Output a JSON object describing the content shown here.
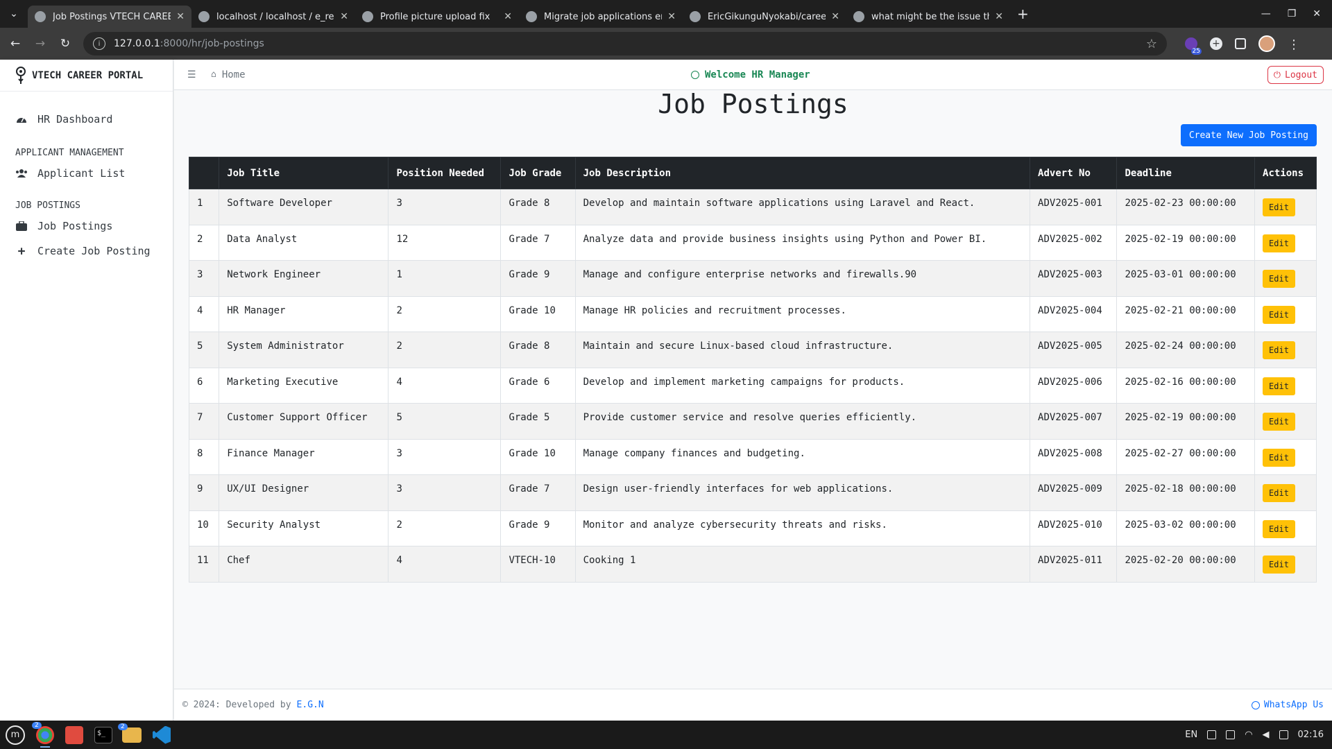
{
  "browser": {
    "tabs": [
      {
        "title": "Job Postings VTECH CAREER",
        "active": true
      },
      {
        "title": "localhost / localhost / e_recr",
        "active": false
      },
      {
        "title": "Profile picture upload fix",
        "active": false
      },
      {
        "title": "Migrate job applications erro",
        "active": false
      },
      {
        "title": "EricGikunguNyokabi/career-",
        "active": false
      },
      {
        "title": "what might be the issue that",
        "active": false
      }
    ],
    "url_host": "127.0.0.1",
    "url_path": ":8000/hr/job-postings",
    "extension_badge": "25"
  },
  "sidebar": {
    "brand": "VTECH CAREER PORTAL",
    "dashboard_label": "HR Dashboard",
    "section_applicants": "APPLICANT MANAGEMENT",
    "applicant_list_label": "Applicant List",
    "section_jobs": "JOB POSTINGS",
    "job_postings_label": "Job Postings",
    "create_job_label": "Create Job Posting"
  },
  "topnav": {
    "home_label": "Home",
    "welcome": "Welcome HR Manager",
    "logout_label": "Logout"
  },
  "main": {
    "title": "Job Postings",
    "create_button": "Create New Job Posting",
    "columns": [
      "",
      "Job Title",
      "Position Needed",
      "Job Grade",
      "Job Description",
      "Advert No",
      "Deadline",
      "Actions"
    ],
    "edit_label": "Edit",
    "rows": [
      {
        "no": "1",
        "title": "Software Developer",
        "positions": "3",
        "grade": "Grade 8",
        "description": "Develop and maintain software applications using Laravel and React.",
        "advert": "ADV2025-001",
        "deadline": "2025-02-23 00:00:00"
      },
      {
        "no": "2",
        "title": "Data Analyst",
        "positions": "12",
        "grade": "Grade 7",
        "description": "Analyze data and provide business insights using Python and Power BI.",
        "advert": "ADV2025-002",
        "deadline": "2025-02-19 00:00:00"
      },
      {
        "no": "3",
        "title": "Network Engineer",
        "positions": "1",
        "grade": "Grade 9",
        "description": "Manage and configure enterprise networks and firewalls.90",
        "advert": "ADV2025-003",
        "deadline": "2025-03-01 00:00:00"
      },
      {
        "no": "4",
        "title": "HR Manager",
        "positions": "2",
        "grade": "Grade 10",
        "description": "Manage HR policies and recruitment processes.",
        "advert": "ADV2025-004",
        "deadline": "2025-02-21 00:00:00"
      },
      {
        "no": "5",
        "title": "System Administrator",
        "positions": "2",
        "grade": "Grade 8",
        "description": "Maintain and secure Linux-based cloud infrastructure.",
        "advert": "ADV2025-005",
        "deadline": "2025-02-24 00:00:00"
      },
      {
        "no": "6",
        "title": "Marketing Executive",
        "positions": "4",
        "grade": "Grade 6",
        "description": "Develop and implement marketing campaigns for products.",
        "advert": "ADV2025-006",
        "deadline": "2025-02-16 00:00:00"
      },
      {
        "no": "7",
        "title": "Customer Support Officer",
        "positions": "5",
        "grade": "Grade 5",
        "description": "Provide customer service and resolve queries efficiently.",
        "advert": "ADV2025-007",
        "deadline": "2025-02-19 00:00:00"
      },
      {
        "no": "8",
        "title": "Finance Manager",
        "positions": "3",
        "grade": "Grade 10",
        "description": "Manage company finances and budgeting.",
        "advert": "ADV2025-008",
        "deadline": "2025-02-27 00:00:00"
      },
      {
        "no": "9",
        "title": "UX/UI Designer",
        "positions": "3",
        "grade": "Grade 7",
        "description": "Design user-friendly interfaces for web applications.",
        "advert": "ADV2025-009",
        "deadline": "2025-02-18 00:00:00"
      },
      {
        "no": "10",
        "title": "Security Analyst",
        "positions": "2",
        "grade": "Grade 9",
        "description": "Monitor and analyze cybersecurity threats and risks.",
        "advert": "ADV2025-010",
        "deadline": "2025-03-02 00:00:00"
      },
      {
        "no": "11",
        "title": "Chef",
        "positions": "4",
        "grade": "VTECH-10",
        "description": "Cooking 1",
        "advert": "ADV2025-011",
        "deadline": "2025-02-20 00:00:00"
      }
    ]
  },
  "footer": {
    "copyright": "© 2024: Developed by",
    "developer": "E.G.N",
    "whatsapp": "WhatsApp Us"
  },
  "taskbar": {
    "chrome_badge": "2",
    "folder_badge": "2",
    "language": "EN",
    "time": "02:16"
  }
}
